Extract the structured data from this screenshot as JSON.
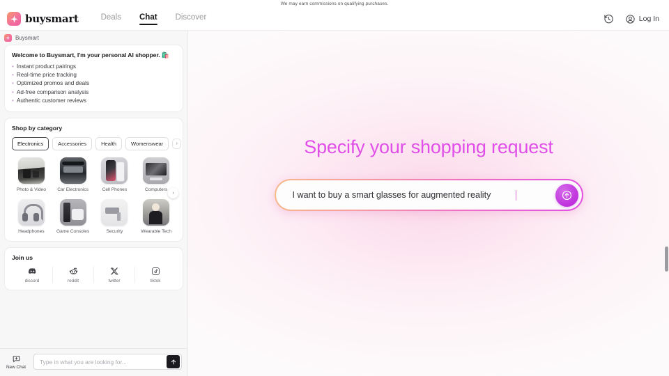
{
  "banner": {
    "text": "We may earn commissions on qualifying purchases."
  },
  "header": {
    "brand_name": "buysmart",
    "brand_icon": "sparkle-icon",
    "nav": [
      {
        "label": "Deals",
        "active": false
      },
      {
        "label": "Chat",
        "active": true
      },
      {
        "label": "Discover",
        "active": false
      }
    ],
    "history_icon": "history-clock-icon",
    "account_icon": "user-circle-icon",
    "login_label": "Log In"
  },
  "sidebar": {
    "agent_chip": {
      "label": "Buysmart",
      "icon": "sparkle-icon"
    },
    "welcome": {
      "title": "Welcome to Buysmart, I'm your personal AI shopper.",
      "title_emoji": "🛍️",
      "bullets": [
        "Instant product pairings",
        "Real-time price tracking",
        "Optimized promos and deals",
        "Ad-free comparison analysis",
        "Authentic customer reviews"
      ]
    },
    "category_section": {
      "title": "Shop by category",
      "chips": [
        {
          "label": "Electronics",
          "selected": true
        },
        {
          "label": "Accessories",
          "selected": false
        },
        {
          "label": "Health",
          "selected": false
        },
        {
          "label": "Womenswear",
          "selected": false
        }
      ],
      "chips_next_icon": "chevron-right-icon",
      "tiles_next_icon": "chevron-right-icon",
      "tiles": [
        {
          "label": "Photo & Video",
          "art": "th-photo"
        },
        {
          "label": "Car Electronics",
          "art": "th-car"
        },
        {
          "label": "Cell Phones",
          "art": "th-phone"
        },
        {
          "label": "Computers",
          "art": "th-computer"
        },
        {
          "label": "Headphones",
          "art": "th-headphones"
        },
        {
          "label": "Game Consoles",
          "art": "th-console"
        },
        {
          "label": "Security",
          "art": "th-security"
        },
        {
          "label": "Wearable Tech",
          "art": "th-wearable"
        }
      ]
    },
    "join_us": {
      "title": "Join us",
      "socials": [
        {
          "label": "discord",
          "icon": "discord-icon"
        },
        {
          "label": "reddit",
          "icon": "reddit-icon"
        },
        {
          "label": "twitter",
          "icon": "twitter-x-icon"
        },
        {
          "label": "tiktok",
          "icon": "tiktok-icon"
        }
      ]
    },
    "composer": {
      "new_chat_label": "New Chat",
      "new_chat_icon": "new-chat-bubble-icon",
      "input_placeholder": "Type in what you are looking for...",
      "input_value": "",
      "send_icon": "arrow-up-icon"
    }
  },
  "main": {
    "hero_title": "Specify your shopping request",
    "hero_input_value": "I want to buy a smart glasses for augmented reality",
    "hero_send_icon": "arrow-up-circle-icon",
    "caret_visible": true
  },
  "colors": {
    "hero_title": "#e050e8",
    "brand_gradient_start": "#f79a6a",
    "brand_gradient_end": "#ef5fa0",
    "send_button": "#c33ce0",
    "active_nav": "#17171a",
    "sidebar_bg": "#f7f7f8"
  }
}
